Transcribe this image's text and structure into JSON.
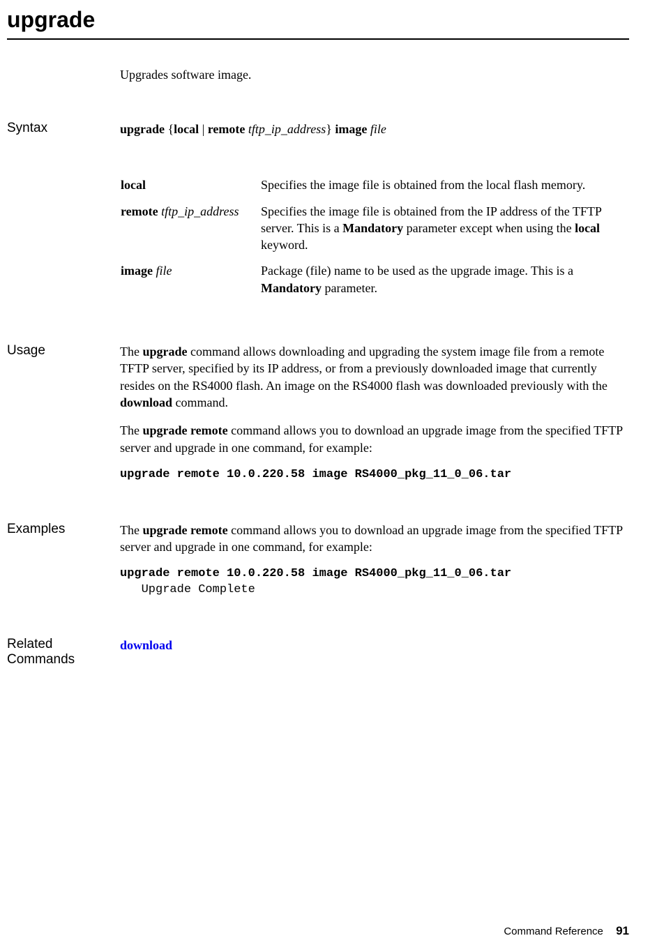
{
  "title": "upgrade",
  "intro": "Upgrades software image.",
  "sections": {
    "syntax": {
      "label": "Syntax",
      "line": {
        "cmd": "upgrade",
        "brace_open": " {",
        "kw_local": "local",
        "pipe": " | ",
        "kw_remote": "remote",
        "sp1": " ",
        "arg_tftp": "tftp_ip_address",
        "brace_close": "} ",
        "kw_image": "image",
        "sp2": " ",
        "arg_file": "file"
      },
      "params": [
        {
          "key_bold": "local",
          "key_ital": "",
          "desc_pre": "Specifies the image file is obtained from the local flash memory.",
          "desc_bold1": "",
          "desc_mid": "",
          "desc_bold2": "",
          "desc_post": ""
        },
        {
          "key_bold": "remote",
          "key_ital": " tftp_ip_address",
          "desc_pre": "Specifies the image file is obtained from the IP address of the TFTP server. This is a ",
          "desc_bold1": "Mandatory",
          "desc_mid": " parameter except when using the ",
          "desc_bold2": "local",
          "desc_post": " keyword."
        },
        {
          "key_bold": "image",
          "key_ital": " file",
          "desc_pre": "Package (file) name to be used as the upgrade image. This is a ",
          "desc_bold1": "Mandatory",
          "desc_mid": " parameter.",
          "desc_bold2": "",
          "desc_post": ""
        }
      ]
    },
    "usage": {
      "label": "Usage",
      "p1": {
        "t1": "The ",
        "b1": "upgrade",
        "t2": " command allows downloading and upgrading the system image file from a remote TFTP server, specified by its IP address, or from a previously downloaded image that currently resides on the RS4000 flash. An image on the RS4000 flash was downloaded previously with the ",
        "b2": "download",
        "t3": " command."
      },
      "p2": {
        "t1": "The ",
        "b1": "upgrade remote",
        "t2": " command allows you to download an upgrade image from the specified TFTP server and upgrade in one command, for example:"
      },
      "code": "upgrade remote 10.0.220.58 image RS4000_pkg_11_0_06.tar"
    },
    "examples": {
      "label": "Examples",
      "p1": {
        "t1": "The ",
        "b1": "upgrade remote",
        "t2": " command allows you to download an upgrade image from the specified TFTP server and upgrade in one command, for example:"
      },
      "code_bold": "upgrade remote 10.0.220.58 image RS4000_pkg_11_0_06.tar",
      "code_plain": "   Upgrade Complete"
    },
    "related": {
      "label": "Related Commands",
      "link": "download"
    }
  },
  "footer": {
    "text": "Command Reference",
    "page": "91"
  }
}
